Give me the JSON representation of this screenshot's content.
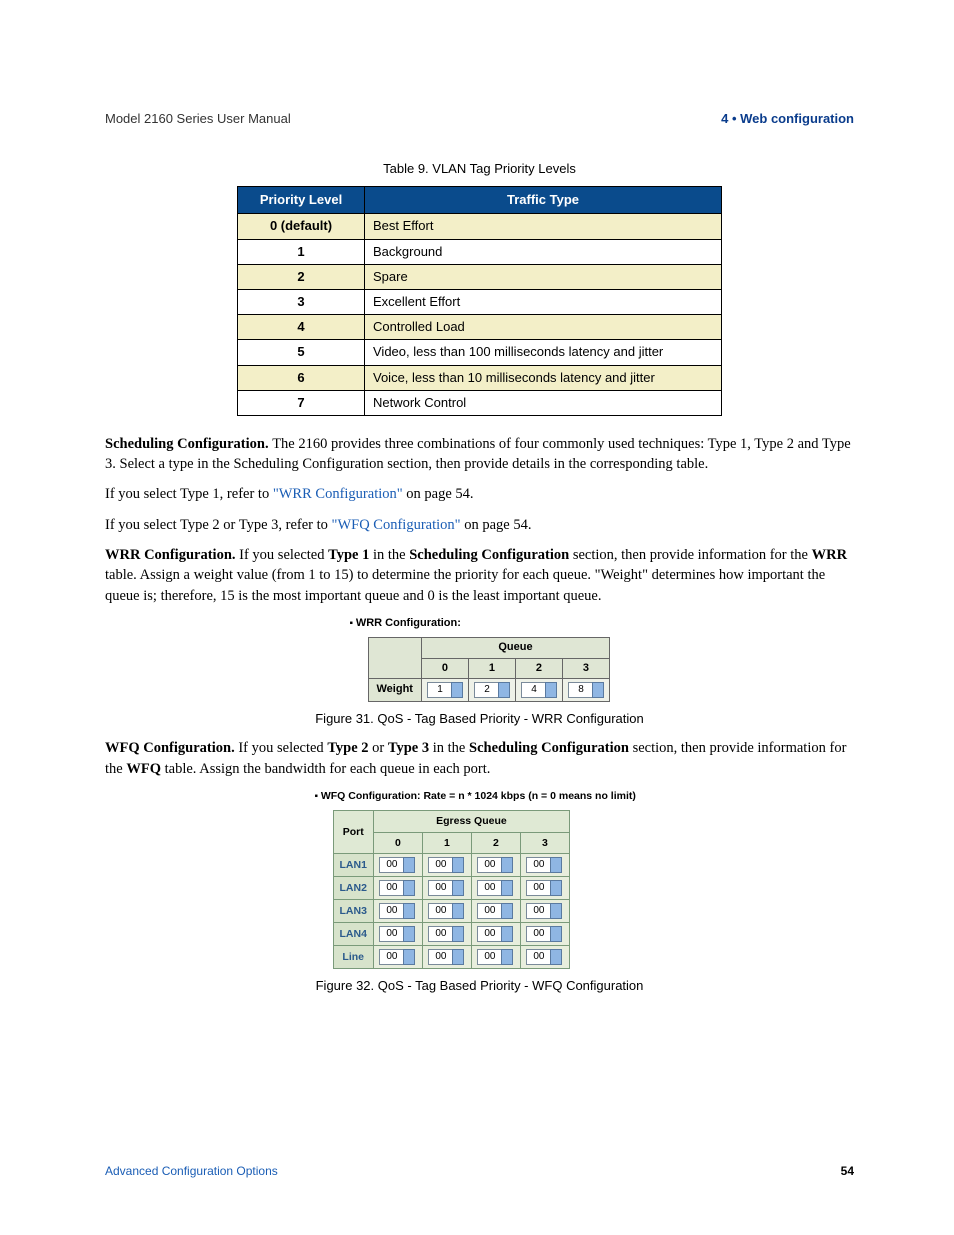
{
  "runningHead": {
    "left": "Model 2160 Series User Manual",
    "right": "4 • Web configuration"
  },
  "table9": {
    "caption": "Table 9. VLAN Tag Priority Levels",
    "headers": [
      "Priority Level",
      "Traffic Type"
    ],
    "rows": [
      {
        "level": "0 (default)",
        "type": "Best Effort",
        "shade": true
      },
      {
        "level": "1",
        "type": "Background",
        "shade": false
      },
      {
        "level": "2",
        "type": "Spare",
        "shade": true
      },
      {
        "level": "3",
        "type": "Excellent Effort",
        "shade": false
      },
      {
        "level": "4",
        "type": "Controlled Load",
        "shade": true
      },
      {
        "level": "5",
        "type": "Video, less than 100 milliseconds latency and jitter",
        "shade": false
      },
      {
        "level": "6",
        "type": "Voice, less than 10 milliseconds latency and jitter",
        "shade": true
      },
      {
        "level": "7",
        "type": "Network Control",
        "shade": false
      }
    ]
  },
  "para_sched": {
    "lead": "Scheduling Configuration. ",
    "text": "The 2160 provides three combinations of four commonly used techniques: Type 1, Type 2 and Type 3.  Select a type in the Scheduling Configuration section, then provide details in the corresponding table."
  },
  "para_type1": {
    "pre": "If you select Type 1, refer to ",
    "link": "\"WRR Configuration\"",
    "post": " on page 54."
  },
  "para_type23": {
    "pre": "If you select Type 2 or Type 3, refer to ",
    "link": "\"WFQ Configuration\"",
    "post": " on page 54."
  },
  "para_wrr": {
    "lead": "WRR Configuration. ",
    "t1": "If you selected ",
    "b1": "Type 1",
    "t2": " in the ",
    "b2": "Scheduling Configuration",
    "t3": " section, then provide information for the ",
    "b3": "WRR",
    "t4": " table.  Assign a weight value (from 1 to 15) to determine the priority for each queue. \"Weight\" determines how important the queue is; therefore, 15 is the most important queue and 0 is the least important queue."
  },
  "fig31": {
    "title": "WRR Configuration:",
    "queueHeader": "Queue",
    "cols": [
      "0",
      "1",
      "2",
      "3"
    ],
    "rowLabel": "Weight",
    "values": [
      "1",
      "2",
      "4",
      "8"
    ],
    "caption": "Figure 31. QoS - Tag Based Priority - WRR Configuration"
  },
  "para_wfq": {
    "lead": "WFQ Configuration. ",
    "t1": "If you selected ",
    "b1": "Type 2",
    "t2": " or ",
    "b2": "Type 3",
    "t3": " in the ",
    "b3": "Scheduling Configuration",
    "t4": " section, then provide information for the ",
    "b4": "WFQ",
    "t5": " table.  Assign the bandwidth for each queue in each port."
  },
  "fig32": {
    "title": "WFQ Configuration: Rate = n * 1024 kbps (n = 0 means no limit)",
    "portHeader": "Port",
    "egressHeader": "Egress Queue",
    "cols": [
      "0",
      "1",
      "2",
      "3"
    ],
    "rows": [
      {
        "port": "LAN1",
        "vals": [
          "00",
          "00",
          "00",
          "00"
        ]
      },
      {
        "port": "LAN2",
        "vals": [
          "00",
          "00",
          "00",
          "00"
        ]
      },
      {
        "port": "LAN3",
        "vals": [
          "00",
          "00",
          "00",
          "00"
        ]
      },
      {
        "port": "LAN4",
        "vals": [
          "00",
          "00",
          "00",
          "00"
        ]
      },
      {
        "port": "Line",
        "vals": [
          "00",
          "00",
          "00",
          "00"
        ]
      }
    ],
    "caption": "Figure 32. QoS - Tag Based Priority - WFQ Configuration"
  },
  "footer": {
    "left": "Advanced Configuration Options",
    "right": "54"
  }
}
